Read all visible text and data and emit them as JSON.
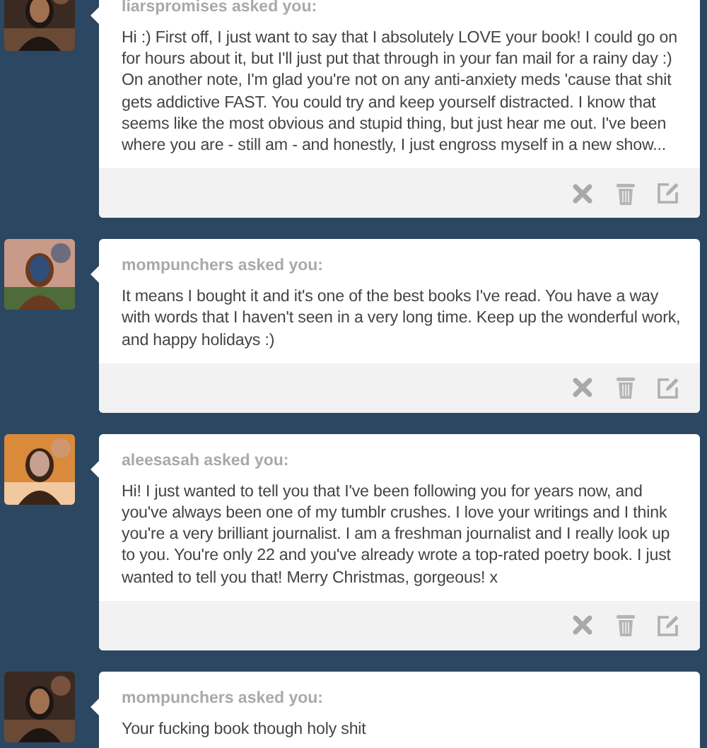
{
  "messages": [
    {
      "asker": "liarspromises asked you:",
      "body": "Hi :) First off, I just want to say that I absolutely LOVE your book! I could go on for hours about it, but I'll just put that through in your fan mail for a rainy day :) On another note, I'm glad you're not on any anti-anxiety meds 'cause that shit gets addictive FAST. You could try and keep yourself distracted. I know that seems like the most obvious and stupid thing, but just hear me out. I've been where you are - still am - and honestly, I just engross myself in a new show...",
      "show_actions": true
    },
    {
      "asker": "mompunchers asked you:",
      "body": "It means I bought it and it's one of the best books I've read. You have a way with words that I haven't seen in a very long time. Keep up the wonderful work, and happy holidays :)",
      "show_actions": true
    },
    {
      "asker": "aleesasah asked you:",
      "body": "Hi! I just wanted to tell you that I've been following you for years now, and you've always been one of my tumblr crushes. I love your writings and I think you're a very brilliant journalist. I am a freshman journalist and I really look up to you. You're only 22 and you've already wrote a top-rated poetry book. I just wanted to tell you that! Merry Christmas, gorgeous! x",
      "show_actions": true
    },
    {
      "asker": "mompunchers asked you:",
      "body": "Your fucking book though holy shit",
      "show_actions": false
    }
  ]
}
